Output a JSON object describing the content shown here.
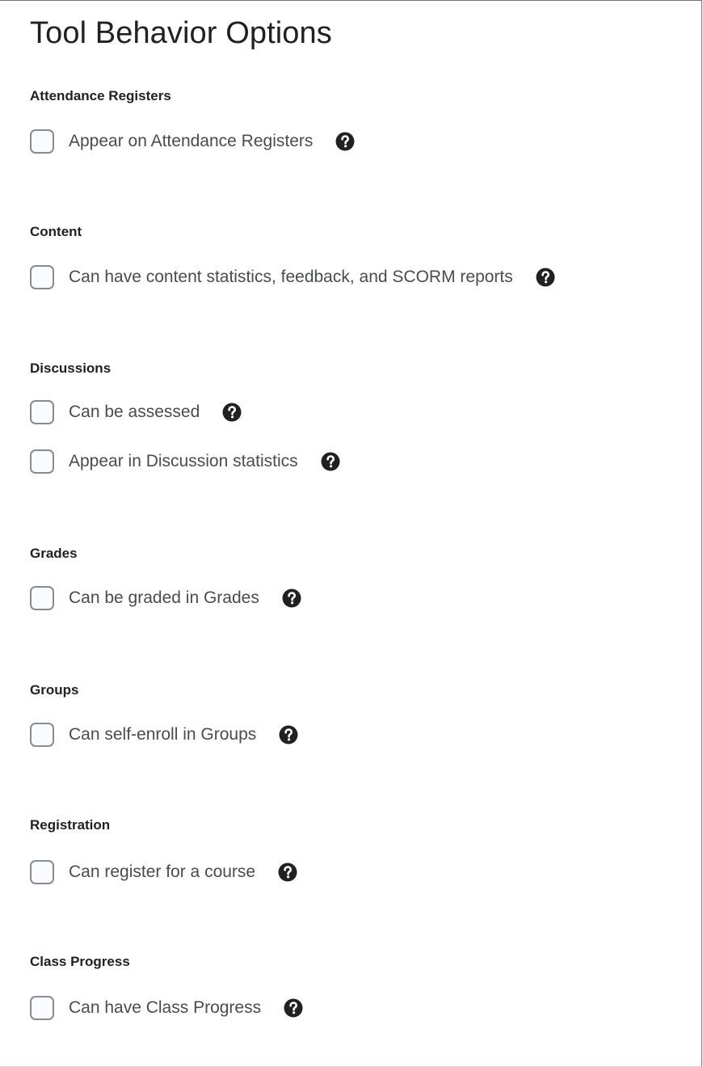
{
  "page": {
    "title": "Tool Behavior Options"
  },
  "sections": [
    {
      "heading": "Attendance Registers",
      "options": [
        {
          "label": "Appear on Attendance Registers",
          "checked": false,
          "help_icon": "help-circle-icon"
        }
      ]
    },
    {
      "heading": "Content",
      "options": [
        {
          "label": "Can have content statistics, feedback, and SCORM reports",
          "checked": false,
          "help_icon": "help-circle-icon"
        }
      ]
    },
    {
      "heading": "Discussions",
      "options": [
        {
          "label": "Can be assessed",
          "checked": false,
          "help_icon": "help-circle-icon"
        },
        {
          "label": "Appear in Discussion statistics",
          "checked": false,
          "help_icon": "help-circle-icon"
        }
      ]
    },
    {
      "heading": "Grades",
      "options": [
        {
          "label": "Can be graded in Grades",
          "checked": false,
          "help_icon": "help-circle-icon"
        }
      ]
    },
    {
      "heading": "Groups",
      "options": [
        {
          "label": "Can self-enroll in Groups",
          "checked": false,
          "help_icon": "help-circle-icon"
        }
      ]
    },
    {
      "heading": "Registration",
      "options": [
        {
          "label": "Can register for a course",
          "checked": false,
          "help_icon": "help-circle-icon"
        }
      ]
    },
    {
      "heading": "Class Progress",
      "options": [
        {
          "label": "Can have Class Progress",
          "checked": false,
          "help_icon": "help-circle-icon"
        }
      ]
    }
  ],
  "colors": {
    "heading_text": "#202122",
    "label_text": "#494c4e",
    "checkbox_border": "#868c8f",
    "checkbox_fill": "#f9fbff",
    "help_icon": "#202122"
  }
}
